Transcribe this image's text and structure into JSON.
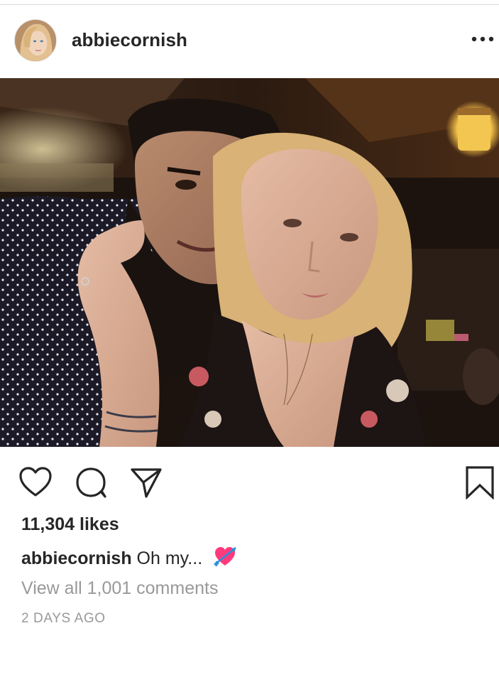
{
  "post": {
    "username": "abbiecornish",
    "likes_text": "11,304 likes",
    "caption_user": "abbiecornish",
    "caption_text": "Oh my...",
    "caption_emoji": "heart-with-arrow",
    "view_comments_text": "View all 1,001 comments",
    "timestamp": "2 DAYS AGO"
  },
  "icons": {
    "more": "more-horizontal-icon",
    "like": "heart-outline-icon",
    "comment": "comment-bubble-icon",
    "share": "paper-plane-icon",
    "save": "bookmark-icon"
  },
  "colors": {
    "text": "#262626",
    "secondary_text": "#999999",
    "divider": "#d8d8d8",
    "emoji_heart": "#ff3a7c",
    "emoji_arrow": "#2b8fd9"
  }
}
